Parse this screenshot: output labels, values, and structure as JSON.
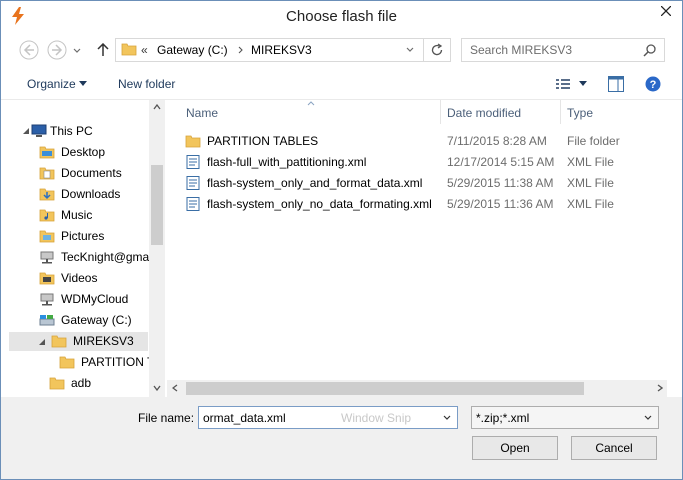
{
  "window": {
    "title": "Choose flash file"
  },
  "address_bar": {
    "overflow": "«",
    "segments": [
      "Gateway (C:)",
      "MIREKSV3"
    ]
  },
  "search": {
    "placeholder": "Search  MIREKSV3"
  },
  "toolbar": {
    "organize_label": "Organize",
    "new_folder_label": "New folder"
  },
  "nav_pane": {
    "items": [
      {
        "label": "This PC",
        "icon": "computer-icon"
      },
      {
        "label": "Desktop",
        "icon": "folder-icon"
      },
      {
        "label": "Documents",
        "icon": "folder-icon"
      },
      {
        "label": "Downloads",
        "icon": "folder-icon"
      },
      {
        "label": "Music",
        "icon": "folder-icon"
      },
      {
        "label": "Pictures",
        "icon": "folder-icon"
      },
      {
        "label": "TecKnight@gma",
        "icon": "network-drive-icon"
      },
      {
        "label": "Videos",
        "icon": "folder-icon"
      },
      {
        "label": "WDMyCloud",
        "icon": "network-drive-icon"
      },
      {
        "label": "Gateway (C:)",
        "icon": "drive-icon"
      },
      {
        "label": "MIREKSV3",
        "icon": "folder-icon"
      },
      {
        "label": "PARTITION T",
        "icon": "folder-icon"
      },
      {
        "label": "adb",
        "icon": "folder-icon"
      }
    ]
  },
  "file_list": {
    "columns": [
      "Name",
      "Date modified",
      "Type"
    ],
    "rows": [
      {
        "name": "PARTITION TABLES",
        "date": "7/11/2015 8:28 AM",
        "type": "File folder",
        "icon": "folder-icon"
      },
      {
        "name": "flash-full_with_pattitioning.xml",
        "date": "12/17/2014 5:15 AM",
        "type": "XML File",
        "icon": "xml-file-icon"
      },
      {
        "name": "flash-system_only_and_format_data.xml",
        "date": "5/29/2015 11:38 AM",
        "type": "XML File",
        "icon": "xml-file-icon"
      },
      {
        "name": "flash-system_only_no_data_formating.xml",
        "date": "5/29/2015 11:36 AM",
        "type": "XML File",
        "icon": "xml-file-icon"
      }
    ]
  },
  "bottom": {
    "file_name_label": "File name:",
    "file_name_value": "ormat_data.xml",
    "file_name_ghost": "Window Snip",
    "file_type_value": "*.zip;*.xml",
    "open_label": "Open",
    "cancel_label": "Cancel"
  }
}
